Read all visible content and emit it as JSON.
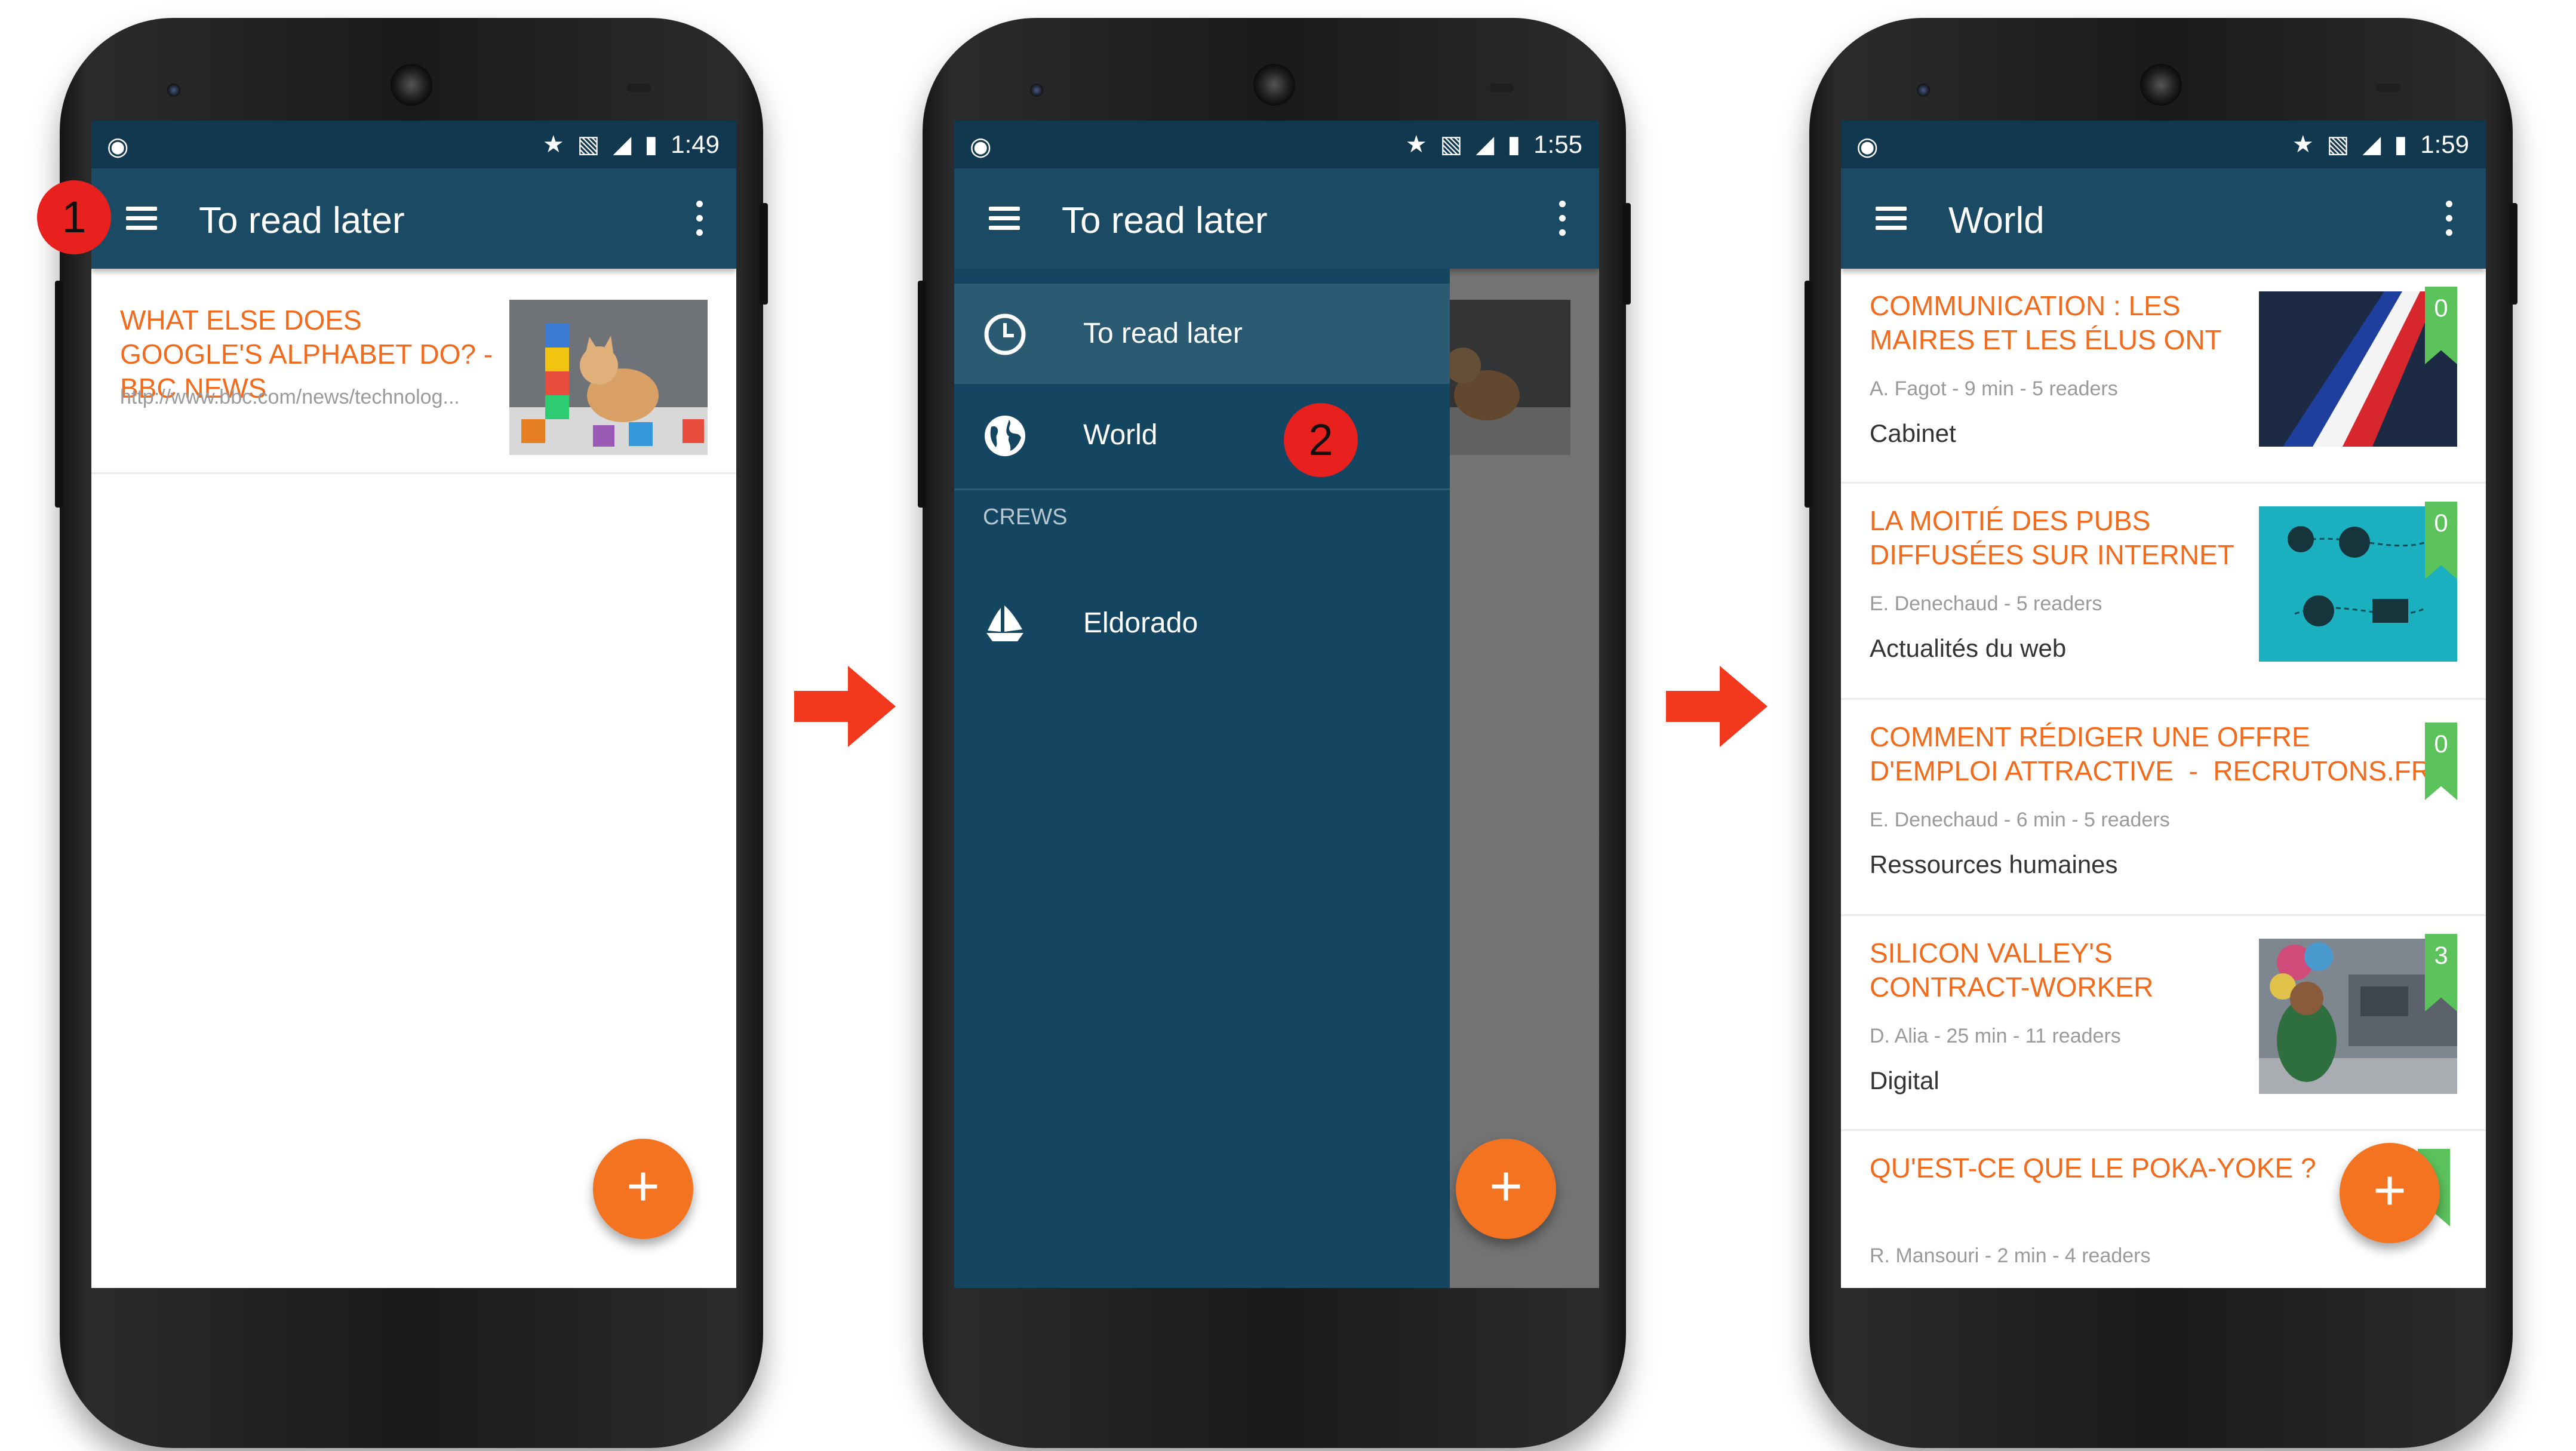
{
  "colors": {
    "status_bar": "#12384f",
    "toolbar": "#1b4a64",
    "drawer": "#144661",
    "accent": "#f26a1b",
    "fab": "#f47320",
    "badge": "#5cc25c",
    "callout": "#e8211f"
  },
  "screen_1": {
    "status": {
      "time": "1:49"
    },
    "toolbar": {
      "title": "To read later"
    },
    "articles": [
      {
        "title": "WHAT ELSE DOES GOOGLE'S ALPHABET DO? - BBC NEWS",
        "url": "http://www.bbc.com/news/technolog...",
        "thumbnail": "kitten-with-letter-blocks"
      }
    ],
    "fab_label": "+",
    "callout": "1"
  },
  "screen_2": {
    "status": {
      "time": "1:55"
    },
    "toolbar": {
      "title": "To read later"
    },
    "drawer": {
      "items": [
        {
          "label": "To read later",
          "icon": "clock-icon",
          "selected": true
        },
        {
          "label": "World",
          "icon": "globe-icon",
          "selected": false
        }
      ],
      "section_title": "CREWS",
      "crews": [
        {
          "label": "Eldorado",
          "icon": "ship-icon"
        }
      ]
    },
    "fab_label": "+",
    "callout": "2"
  },
  "screen_3": {
    "status": {
      "time": "1:59"
    },
    "toolbar": {
      "title": "World"
    },
    "articles": [
      {
        "title_line1": "COMMUNICATION : LES",
        "title_line2": "MAIRES ET LES ÉLUS ONT",
        "meta": "A. Fagot - 9 min - 5 readers",
        "crew": "Cabinet",
        "badge": "0",
        "thumbnail": "tricolor-sash"
      },
      {
        "title_line1": "LA MOITIÉ DES PUBS",
        "title_line2": "DIFFUSÉES SUR INTERNET",
        "meta": "E. Denechaud - 5 readers",
        "crew": "Actualités du web",
        "badge": "0",
        "thumbnail": "teal-infographic"
      },
      {
        "title_line1": "COMMENT RÉDIGER UNE OFFRE",
        "title_line2": "D'EMPLOI ATTRACTIVE  -  RECRUTONS.FR",
        "meta": "E. Denechaud - 6 min - 5 readers",
        "crew": "Ressources humaines",
        "badge": "0",
        "thumbnail": ""
      },
      {
        "title_line1": "SILICON VALLEY'S",
        "title_line2": "CONTRACT-WORKER",
        "meta": "D. Alia - 25 min - 11 readers",
        "crew": "Digital",
        "badge": "3",
        "thumbnail": "street-vendor-balloons"
      },
      {
        "title_line1": "QU'EST-CE QUE LE POKA-YOKE ?",
        "title_line2": "",
        "meta": "R. Mansouri - 2 min - 4 readers",
        "crew": "",
        "badge": "",
        "thumbnail": ""
      }
    ],
    "fab_label": "+"
  }
}
